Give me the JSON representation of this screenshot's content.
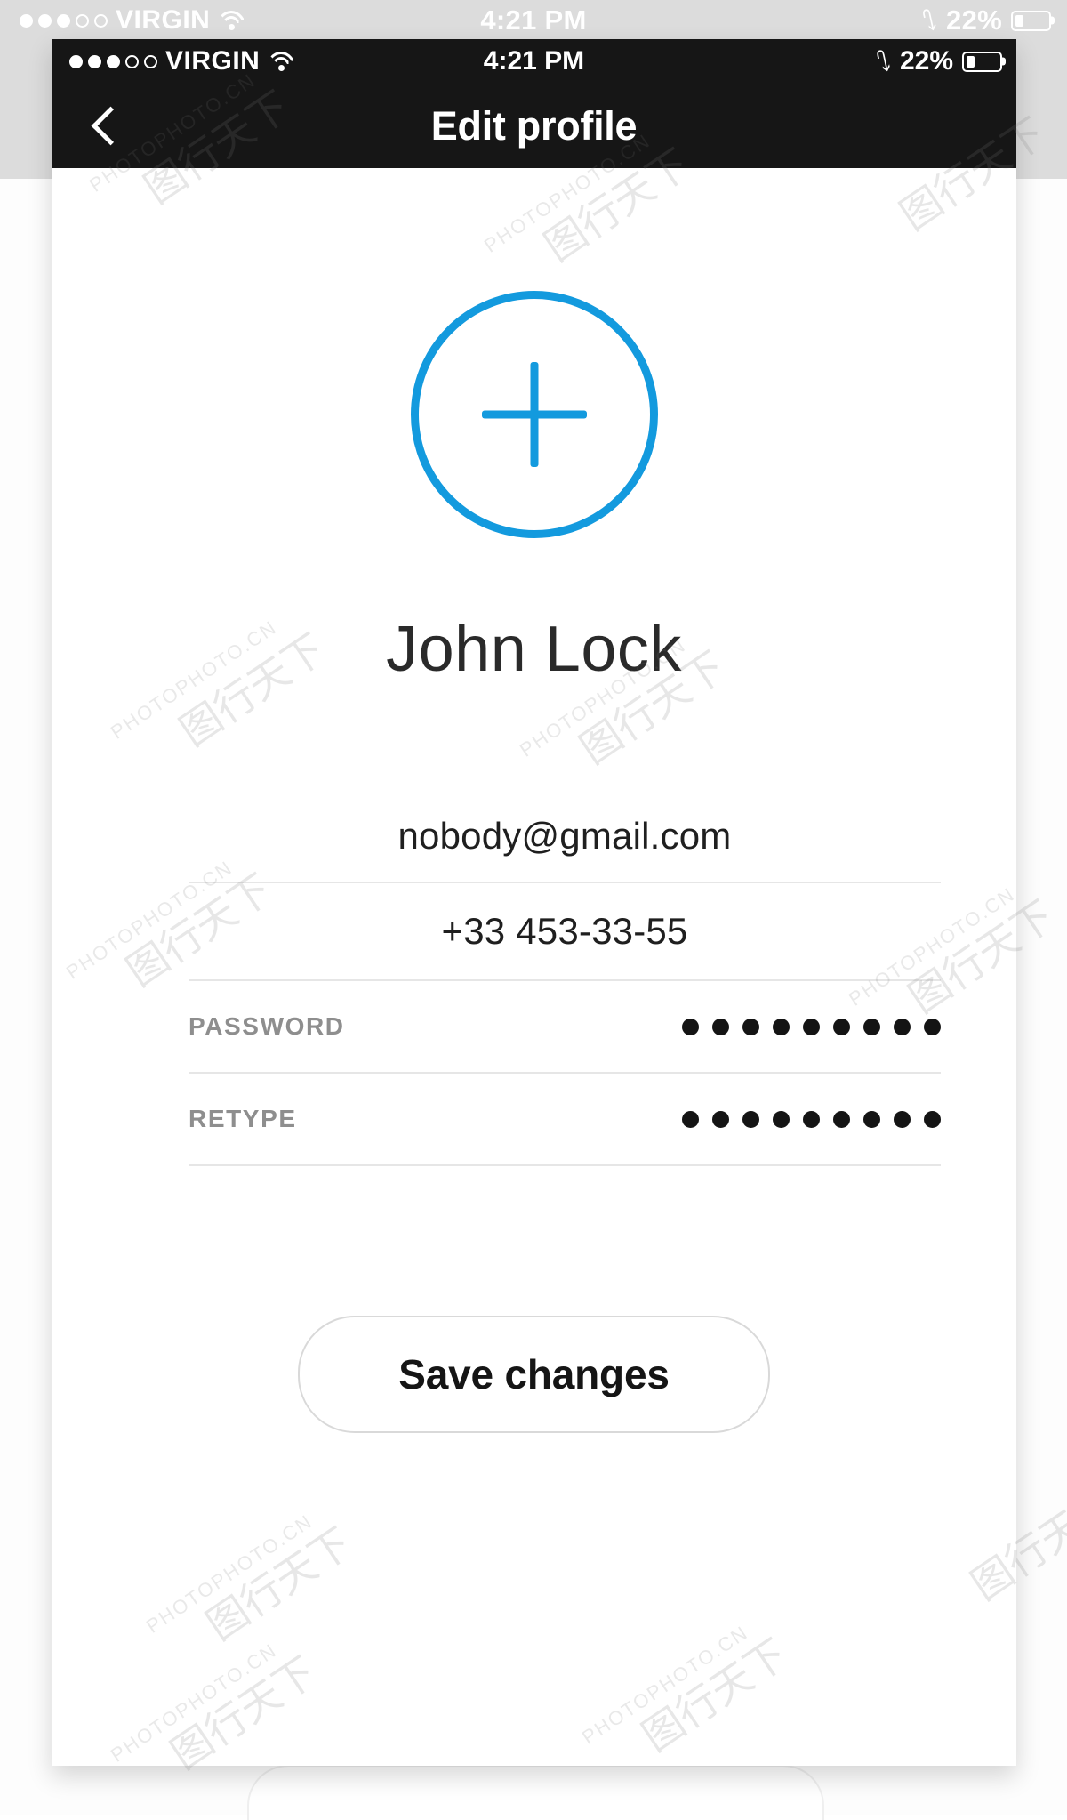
{
  "outer_status_bar": {
    "signal_dots": [
      "filled",
      "filled",
      "filled",
      "hollow",
      "hollow"
    ],
    "carrier": "VIRGIN",
    "wifi_icon": "wifi-icon",
    "time": "4:21 PM",
    "bluetooth_icon": "bluetooth-icon",
    "battery_percent": "22%",
    "battery_level": 22
  },
  "phone": {
    "status_bar": {
      "signal_dots": [
        "filled",
        "filled",
        "filled",
        "hollow",
        "hollow"
      ],
      "carrier": "VIRGIN",
      "wifi_icon": "wifi-icon",
      "time": "4:21 PM",
      "bluetooth_icon": "bluetooth-icon",
      "battery_percent": "22%",
      "battery_level": 22
    },
    "navbar": {
      "back_icon": "chevron-left-icon",
      "title": "Edit profile"
    },
    "avatar": {
      "icon": "plus-icon",
      "accent_color": "#139ADE"
    },
    "user_name": "John Lock",
    "fields": [
      {
        "name": "email",
        "value": "nobody@gmail.com",
        "label": "",
        "masked": false
      },
      {
        "name": "phone",
        "value": "+33 453-33-55",
        "label": "",
        "masked": false
      },
      {
        "name": "password",
        "label": "PASSWORD",
        "value": "",
        "masked": true,
        "mask_dots": 9
      },
      {
        "name": "retype",
        "label": "RETYPE",
        "value": "",
        "masked": true,
        "mask_dots": 9
      }
    ],
    "save_button_label": "Save changes"
  },
  "watermark": {
    "text": "PHOTOPHOTO.CN",
    "mark": "图行天下"
  },
  "colors": {
    "accent": "#139ADE",
    "navbar_bg": "#161616",
    "page_backdrop": "#dcdcdc",
    "divider": "#e6e6e6",
    "label_gray": "#8e8e8e"
  }
}
